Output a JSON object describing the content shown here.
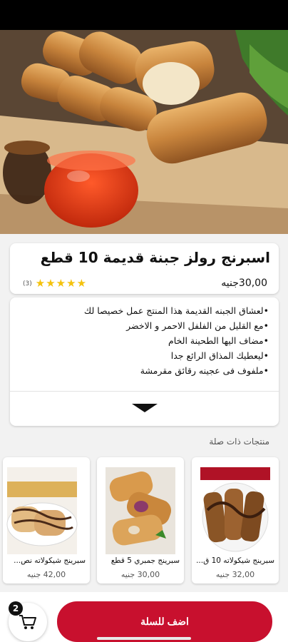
{
  "product": {
    "title": "اسبرنج رولز جبنة قديمة 10 قطع",
    "price": "30,00جنيه",
    "rating_count": "(3)",
    "stars": 5,
    "description_lines": [
      "•لعشاق الجبنه القديمة هذا المنتج عمل خصيصا لك",
      "•مع القليل من الفلفل الاحمر و الاخضر",
      "•مضاف اليها الطحينة الخام",
      "•ليعطيك المذاق الرائع جدا",
      "•ملفوف فى عجينه رقائق مقرمشة"
    ],
    "expand_icon": "chevron-down-icon"
  },
  "related": {
    "heading": "منتجات ذات صلة",
    "items": [
      {
        "name": "سبرينج شيكولاته 10 ق...",
        "price": "32,00 جنيه"
      },
      {
        "name": "سبرينج جمبري 5 قطع",
        "price": "30,00 جنيه"
      },
      {
        "name": "سبرينج شيكولاته نص...",
        "price": "42,00 جنيه"
      }
    ]
  },
  "cart": {
    "count": "2",
    "icon": "cart-icon"
  },
  "actions": {
    "add_to_cart": "اضف للسلة"
  },
  "colors": {
    "accent": "#c8102e",
    "star": "#f4c20d"
  }
}
